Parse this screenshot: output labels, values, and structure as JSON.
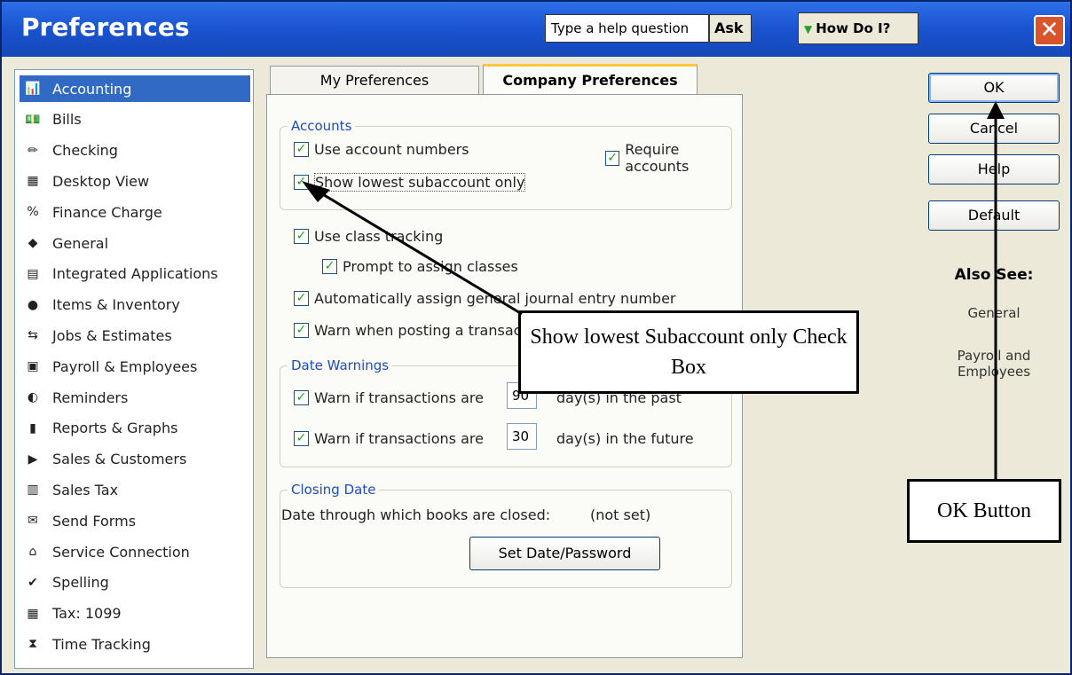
{
  "window": {
    "title": "Preferences"
  },
  "toolbar": {
    "help_placeholder": "Type a help question",
    "ask": "Ask",
    "howdoi": "How Do I?",
    "close": "✕"
  },
  "sidebar": {
    "items": [
      {
        "label": "Accounting",
        "icon": "📊"
      },
      {
        "label": "Bills",
        "icon": "💵"
      },
      {
        "label": "Checking",
        "icon": "✏"
      },
      {
        "label": "Desktop View",
        "icon": "▦"
      },
      {
        "label": "Finance Charge",
        "icon": "%"
      },
      {
        "label": "General",
        "icon": "◆"
      },
      {
        "label": "Integrated Applications",
        "icon": "▤"
      },
      {
        "label": "Items & Inventory",
        "icon": "●"
      },
      {
        "label": "Jobs & Estimates",
        "icon": "⇆"
      },
      {
        "label": "Payroll & Employees",
        "icon": "▣"
      },
      {
        "label": "Reminders",
        "icon": "◐"
      },
      {
        "label": "Reports & Graphs",
        "icon": "▮"
      },
      {
        "label": "Sales & Customers",
        "icon": "▶"
      },
      {
        "label": "Sales Tax",
        "icon": "▥"
      },
      {
        "label": "Send Forms",
        "icon": "✉"
      },
      {
        "label": "Service Connection",
        "icon": "⌂"
      },
      {
        "label": "Spelling",
        "icon": "✔"
      },
      {
        "label": "Tax: 1099",
        "icon": "▦"
      },
      {
        "label": "Time Tracking",
        "icon": "⧗"
      }
    ]
  },
  "tabs": {
    "my": "My Preferences",
    "company": "Company Preferences"
  },
  "accounts": {
    "legend": "Accounts",
    "use_account_numbers": "Use account numbers",
    "require_accounts": "Require accounts",
    "show_lowest": "Show lowest subaccount only"
  },
  "class_tracking": {
    "use_class": "Use class tracking",
    "prompt_assign": "Prompt to assign classes",
    "auto_assign": "Automatically assign general journal entry number",
    "warn_posting": "Warn when posting a transaction to Retained Earnings"
  },
  "date_warnings": {
    "legend": "Date Warnings",
    "past_label": "Warn if transactions are",
    "past_days": "90",
    "past_suffix": "day(s) in the past",
    "future_label": "Warn if transactions are",
    "future_days": "30",
    "future_suffix": "day(s) in the future"
  },
  "closing": {
    "legend": "Closing Date",
    "text": "Date through which books are closed:",
    "value": "(not set)",
    "button": "Set Date/Password"
  },
  "buttons": {
    "ok": "OK",
    "cancel": "Cancel",
    "help": "Help",
    "default": "Default"
  },
  "also_see": {
    "heading": "Also See:",
    "general": "General",
    "payroll": "Payroll and Employees"
  },
  "callouts": {
    "subaccount": "Show lowest Subaccount only Check Box",
    "ok": "OK Button"
  }
}
